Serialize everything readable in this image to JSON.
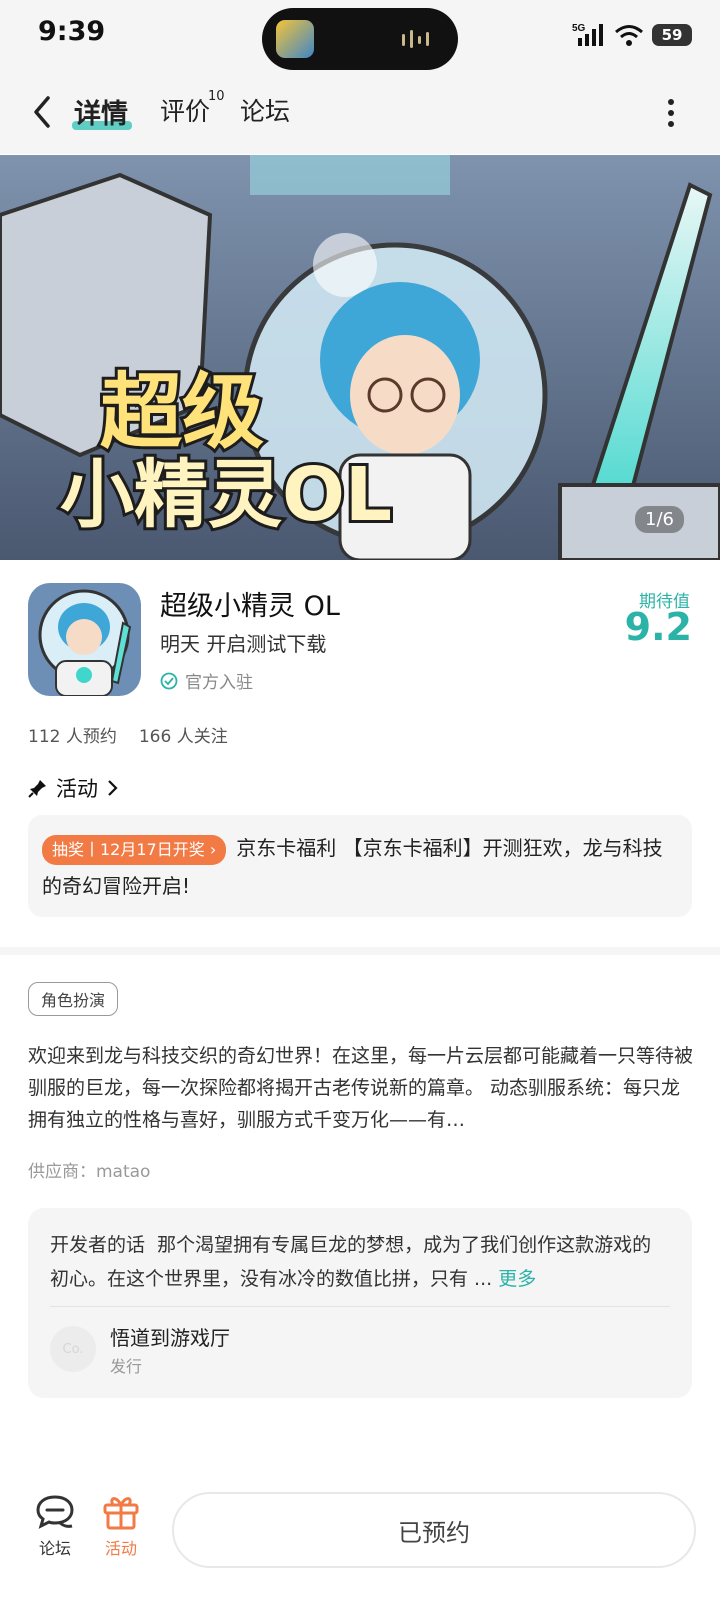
{
  "status_bar": {
    "time": "9:39",
    "network": "5G",
    "battery": "59"
  },
  "nav": {
    "tabs": [
      {
        "label": "详情",
        "active": true
      },
      {
        "label": "评价",
        "badge": "10"
      },
      {
        "label": "论坛"
      }
    ]
  },
  "banner": {
    "title_art": [
      "超级",
      "小精灵OL"
    ],
    "pager": "1/6"
  },
  "game": {
    "name": "超级小精灵 OL",
    "subtitle": "明天 开启测试下载",
    "official": "官方入驻",
    "expect_label": "期待值",
    "expect_value": "9.2",
    "reservations": "112 人预约",
    "followers": "166 人关注"
  },
  "activity": {
    "heading": "活动",
    "tag": "抽奖丨12月17日开奖",
    "text": "京东卡福利 【京东卡福利】开测狂欢，龙与科技的奇幻冒险开启!"
  },
  "details": {
    "genre_tag": "角色扮演",
    "description": "欢迎来到龙与科技交织的奇幻世界！在这里，每一片云层都可能藏着一只等待被驯服的巨龙，每一次探险都将揭开古老传说新的篇章。 动态驯服系统：每只龙拥有独立的性格与喜好，驯服方式千变万化——有…",
    "supplier": "供应商：matao"
  },
  "developer": {
    "label": "开发者的话",
    "text": "那个渴望拥有专属巨龙的梦想，成为了我们创作这款游戏的初心。在这个世界里，没有冰冷的数值比拼，只有 ...",
    "more": "更多",
    "publisher_avatar": "Co.",
    "publisher_name": "悟道到游戏厅",
    "publisher_role": "发行"
  },
  "bottom": {
    "forum": "论坛",
    "activity": "活动",
    "reserve": "已预约"
  },
  "colors": {
    "accent": "#2bb3a8",
    "orange": "#f27a45"
  }
}
